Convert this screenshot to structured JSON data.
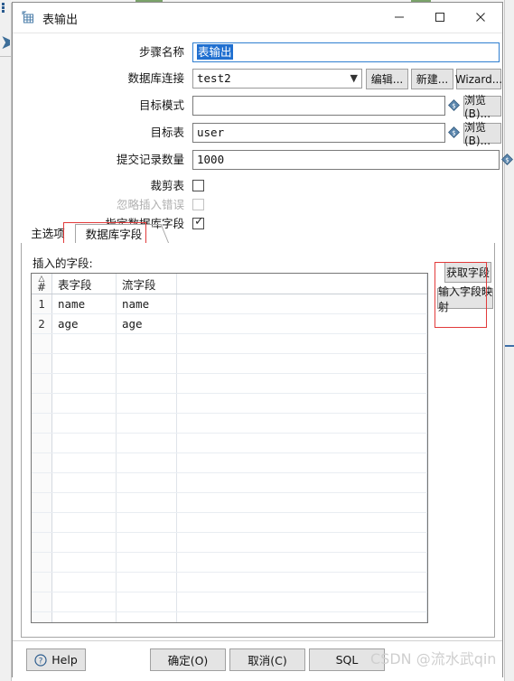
{
  "window": {
    "title": "表输出",
    "icon": "table-output-icon",
    "minimize_label": "—",
    "maximize_label": "□",
    "close_label": "✕"
  },
  "form": {
    "step_name": {
      "label": "步骤名称",
      "value": "表输出",
      "selected": true
    },
    "db_connection": {
      "label": "数据库连接",
      "value": "test2",
      "options": [
        "test2"
      ],
      "buttons": [
        {
          "name": "edit",
          "label": "编辑..."
        },
        {
          "name": "new",
          "label": "新建..."
        },
        {
          "name": "wizard",
          "label": "Wizard..."
        }
      ]
    },
    "target_schema": {
      "label": "目标模式",
      "value": "",
      "browse_label": "浏览(B)..."
    },
    "target_table": {
      "label": "目标表",
      "value": "user",
      "browse_label": "浏览(B)..."
    },
    "commit_size": {
      "label": "提交记录数量",
      "value": "1000"
    },
    "truncate_table": {
      "label": "裁剪表",
      "checked": false,
      "disabled": false
    },
    "ignore_insert_errors": {
      "label": "忽略插入错误",
      "checked": false,
      "disabled": true
    },
    "specify_db_fields": {
      "label": "指定数据库字段",
      "checked": true,
      "disabled": false
    }
  },
  "tabs": [
    {
      "label": "主选项",
      "active": false
    },
    {
      "label": "数据库字段",
      "active": true
    }
  ],
  "panel": {
    "fields_label": "插入的字段:",
    "table": {
      "columns": [
        "#",
        "表字段",
        "流字段",
        ""
      ],
      "rows": [
        {
          "index": "1",
          "table_field": "name",
          "stream_field": "name"
        },
        {
          "index": "2",
          "table_field": "age",
          "stream_field": "age"
        }
      ],
      "empty_row_count": 16
    },
    "side_buttons": [
      {
        "name": "get-fields",
        "label": "获取字段"
      },
      {
        "name": "input-field-mapping",
        "label": "输入字段映射"
      }
    ]
  },
  "footer": {
    "help_label": "Help",
    "help_icon": "question-circle-icon",
    "buttons": [
      {
        "name": "ok",
        "label": "确定(O)"
      },
      {
        "name": "cancel",
        "label": "取消(C)"
      },
      {
        "name": "sql",
        "label": "SQL"
      }
    ]
  },
  "watermark": "CSDN @流水武qin",
  "colors": {
    "selection_blue": "#1f6fd0",
    "focus_border": "#2f7fd1",
    "highlight_red": "#e23b3b",
    "button_face": "#e4e4e4",
    "variable_icon": "#3d6e99"
  }
}
